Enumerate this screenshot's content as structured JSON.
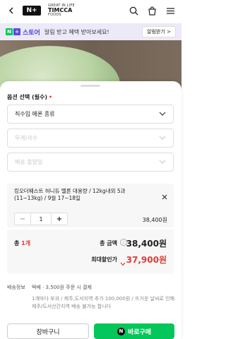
{
  "header": {
    "nplus_label": "N+",
    "brand_line1": "GREAT IN LIFE",
    "brand_line2": "TIMCCA",
    "brand_line3": "FOODS"
  },
  "store_banner": {
    "store_label": "스토어",
    "message": "알림 받고 혜택 받아보세요!",
    "app_button": "알림받기 >"
  },
  "options": {
    "title": "옵션 선택 (필수)",
    "required_mark": "•",
    "select1": "직수입 메론 종류",
    "select2": "무게/과수",
    "select3": "배송 출발일"
  },
  "selected_item": {
    "name": "킹오더웨스트 허니듀 멜론 대용량 / 12kg내외 5과 (11~13kg) / 9월 17~18일",
    "quantity": "1",
    "price": "38,400원"
  },
  "total": {
    "count_label": "총",
    "count_num": "1개",
    "amount_label": "총 금액",
    "amount": "38,400원",
    "discount_label": "최대할인가",
    "discount_amount": "37,900원"
  },
  "shipping": {
    "label": "배송정보",
    "main": "택배 · 3,500원 주문 시 결제",
    "note": "1개마다 부과 / 제주,도서지역 추가 100,000원 / 뜨거운 날씨로 인해 제주/도서산간지역 배송 불가능 합니다"
  },
  "actions": {
    "cart": "장바구니",
    "buy": "바로구매"
  },
  "colors": {
    "accent_green": "#03c75a",
    "price_red": "#e53935",
    "store_purple": "#4a3ce0"
  }
}
